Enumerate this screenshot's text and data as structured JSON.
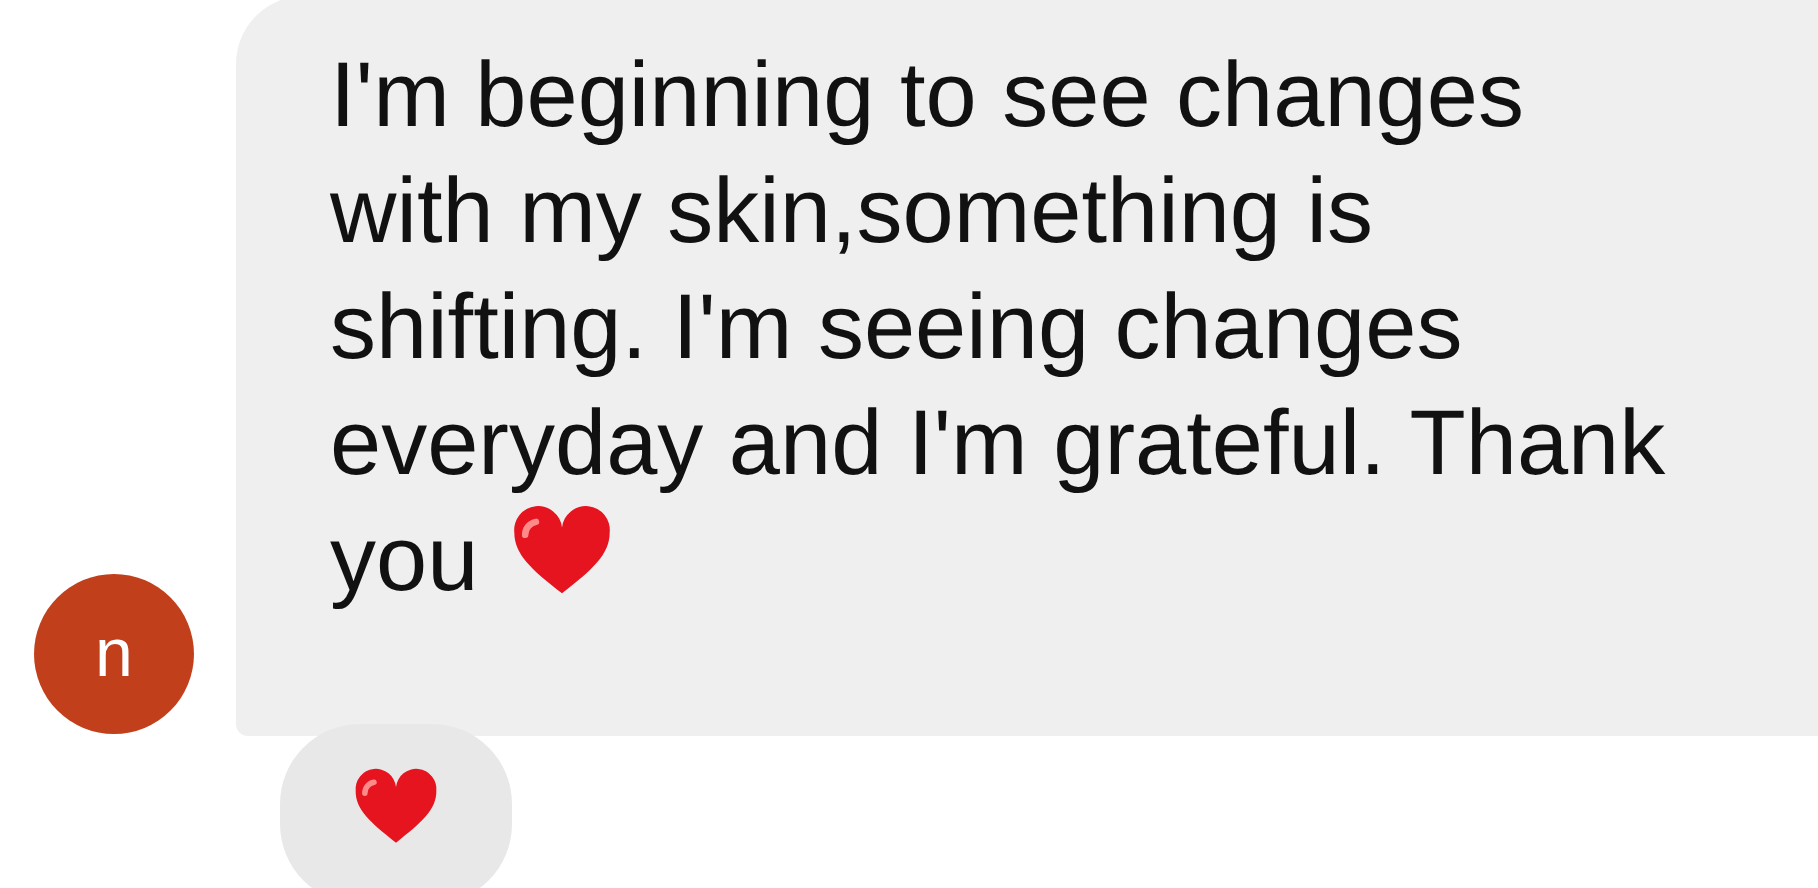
{
  "sender": {
    "initial": "n"
  },
  "message": {
    "lines": [
      "I'm beginning to see changes",
      "with my skin,something is",
      "shifting. I'm seeing changes",
      "everyday and I'm grateful. Thank",
      "you"
    ]
  },
  "reaction": {
    "kind": "heart"
  }
}
